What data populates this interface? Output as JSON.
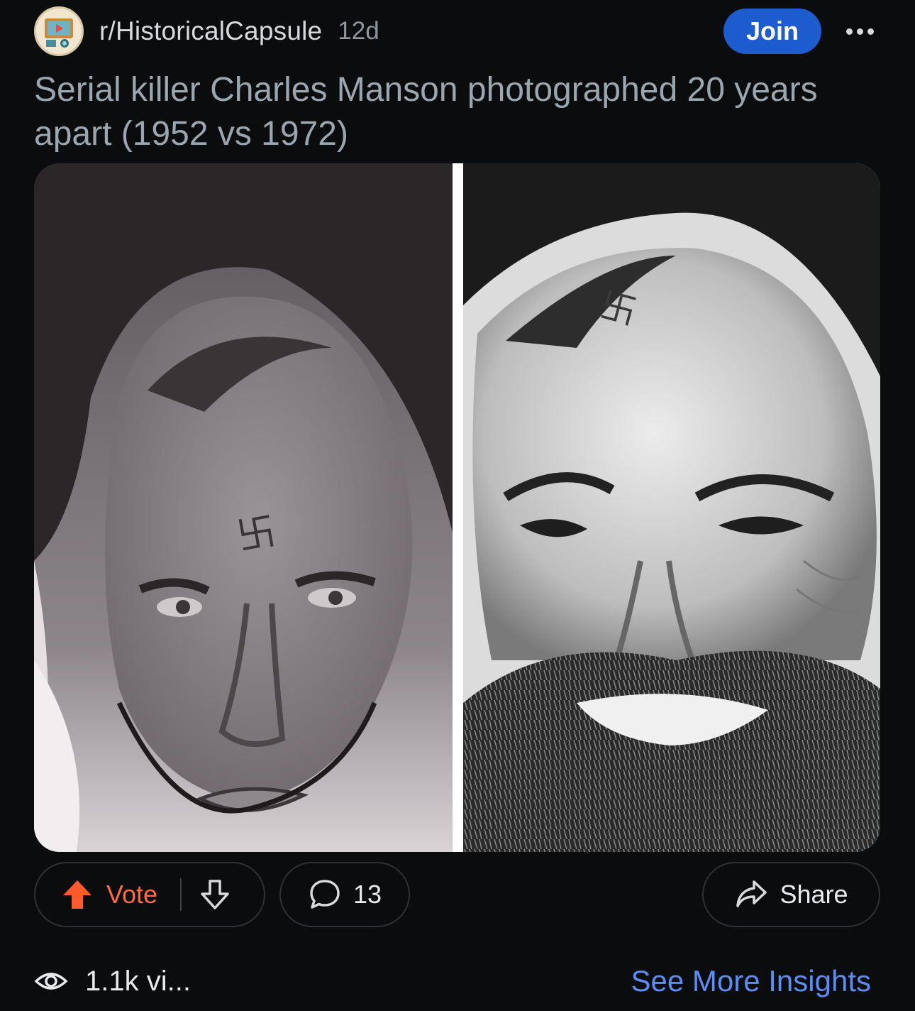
{
  "post": {
    "subreddit": "r/HistoricalCapsule",
    "age": "12d",
    "join_label": "Join",
    "title": "Serial killer Charles Manson photographed 20 years apart (1952 vs 1972)",
    "media": {
      "left_image_alt": "Illustrated portrait of a young man with a mark on his forehead (1952)",
      "right_image_alt": "Black and white photograph of a bearded smiling man with a mark on his forehead (1972)"
    },
    "actions": {
      "vote_label": "Vote",
      "comments_count": "13",
      "share_label": "Share"
    },
    "footer": {
      "views": "1.1k vi...",
      "insights_label": "See More Insights"
    }
  },
  "colors": {
    "background": "#0b0c0e",
    "join_button": "#1d5ccf",
    "upvote": "#ff6a3d",
    "insights_link": "#5c8df5",
    "title": "#9aa7b0"
  },
  "icons": [
    "subreddit-avatar-icon",
    "more-options-icon",
    "upvote-icon",
    "downvote-icon",
    "comment-icon",
    "share-icon",
    "eye-icon"
  ]
}
